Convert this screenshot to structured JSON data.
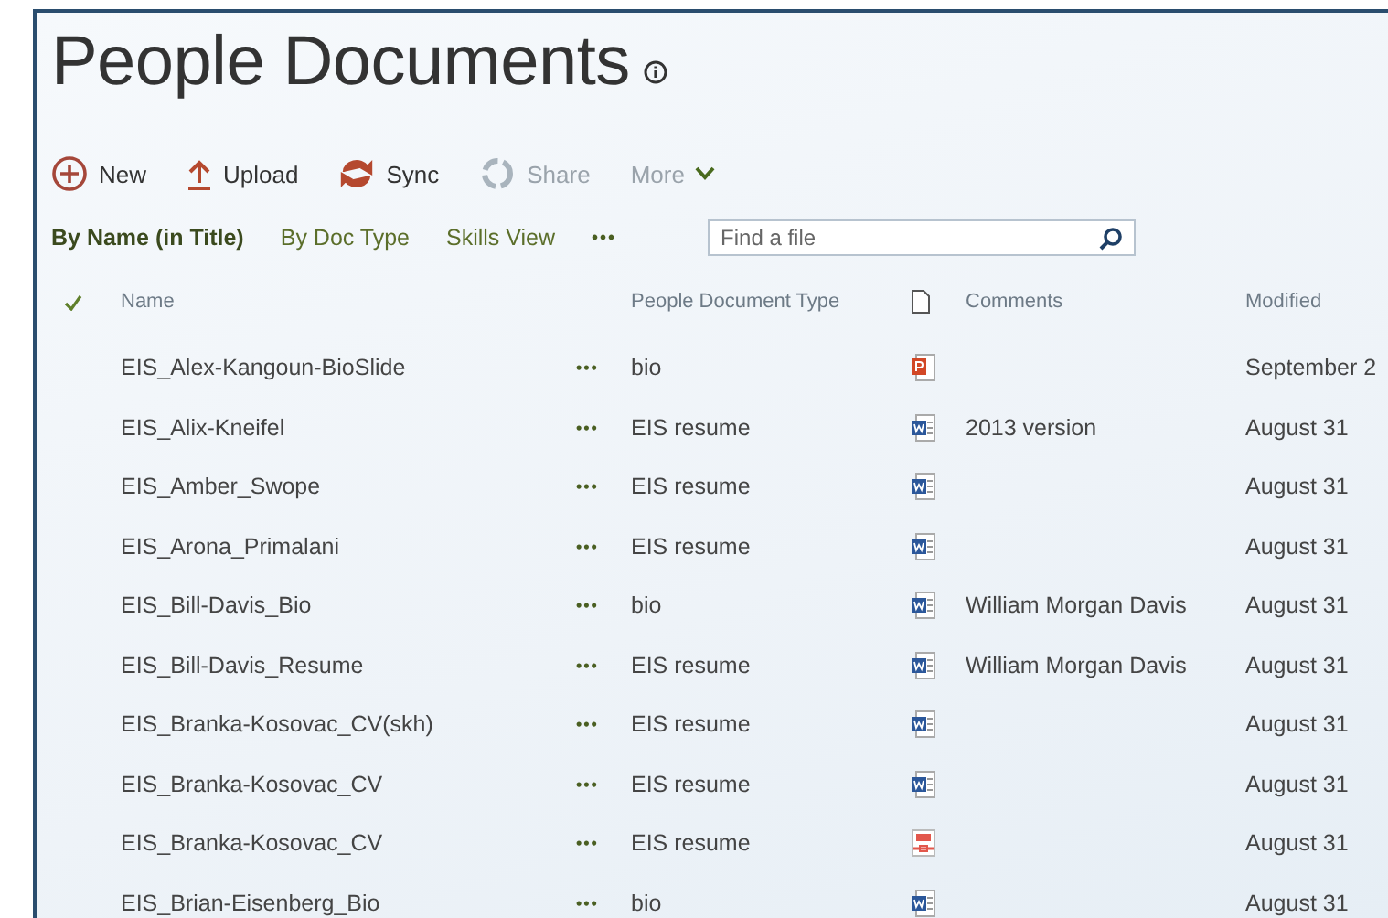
{
  "title": "People Documents",
  "toolbar": [
    {
      "kind": "new",
      "label": "New",
      "disabled": false
    },
    {
      "kind": "upload",
      "label": "Upload",
      "disabled": false
    },
    {
      "kind": "sync",
      "label": "Sync",
      "disabled": false
    },
    {
      "kind": "share",
      "label": "Share",
      "disabled": true
    },
    {
      "kind": "more",
      "label": "More",
      "disabled": true
    }
  ],
  "views": [
    {
      "label": "By Name (in Title)",
      "selected": true
    },
    {
      "label": "By Doc Type",
      "selected": false
    },
    {
      "label": "Skills View",
      "selected": false
    }
  ],
  "views_more": "•••",
  "search": {
    "placeholder": "Find a file"
  },
  "table": {
    "columns": [
      "Name",
      "People Document Type",
      "Comments",
      "Modified"
    ],
    "rows": [
      {
        "name": "EIS_Alex-Kangoun-BioSlide",
        "menu": "•••",
        "type": "bio",
        "kind": "ppt",
        "modified": "September 2"
      },
      {
        "name": "EIS_Alix-Kneifel",
        "menu": "•••",
        "type": "EIS resume",
        "kind": "word",
        "comments": "2013 version",
        "modified": "August 31"
      },
      {
        "name": "EIS_Amber_Swope",
        "menu": "•••",
        "type": "EIS resume",
        "kind": "word",
        "modified": "August 31"
      },
      {
        "name": "EIS_Arona_Primalani",
        "menu": "•••",
        "type": "EIS resume",
        "kind": "word",
        "modified": "August 31"
      },
      {
        "name": "EIS_Bill-Davis_Bio",
        "menu": "•••",
        "type": "bio",
        "kind": "word",
        "comments": "William Morgan Davis",
        "modified": "August 31"
      },
      {
        "name": "EIS_Bill-Davis_Resume",
        "menu": "•••",
        "type": "EIS resume",
        "kind": "word",
        "comments": "William Morgan Davis",
        "modified": "August 31"
      },
      {
        "name": "EIS_Branka-Kosovac_CV(skh)",
        "menu": "•••",
        "type": "EIS resume",
        "kind": "word",
        "modified": "August 31"
      },
      {
        "name": "EIS_Branka-Kosovac_CV",
        "menu": "•••",
        "type": "EIS resume",
        "kind": "word",
        "modified": "August 31"
      },
      {
        "name": "EIS_Branka-Kosovac_CV",
        "menu": "•••",
        "type": "EIS resume",
        "kind": "pdf",
        "modified": "August 31"
      },
      {
        "name": "EIS_Brian-Eisenberg_Bio",
        "menu": "•••",
        "type": "bio",
        "kind": "word",
        "modified": "August 31"
      }
    ]
  }
}
